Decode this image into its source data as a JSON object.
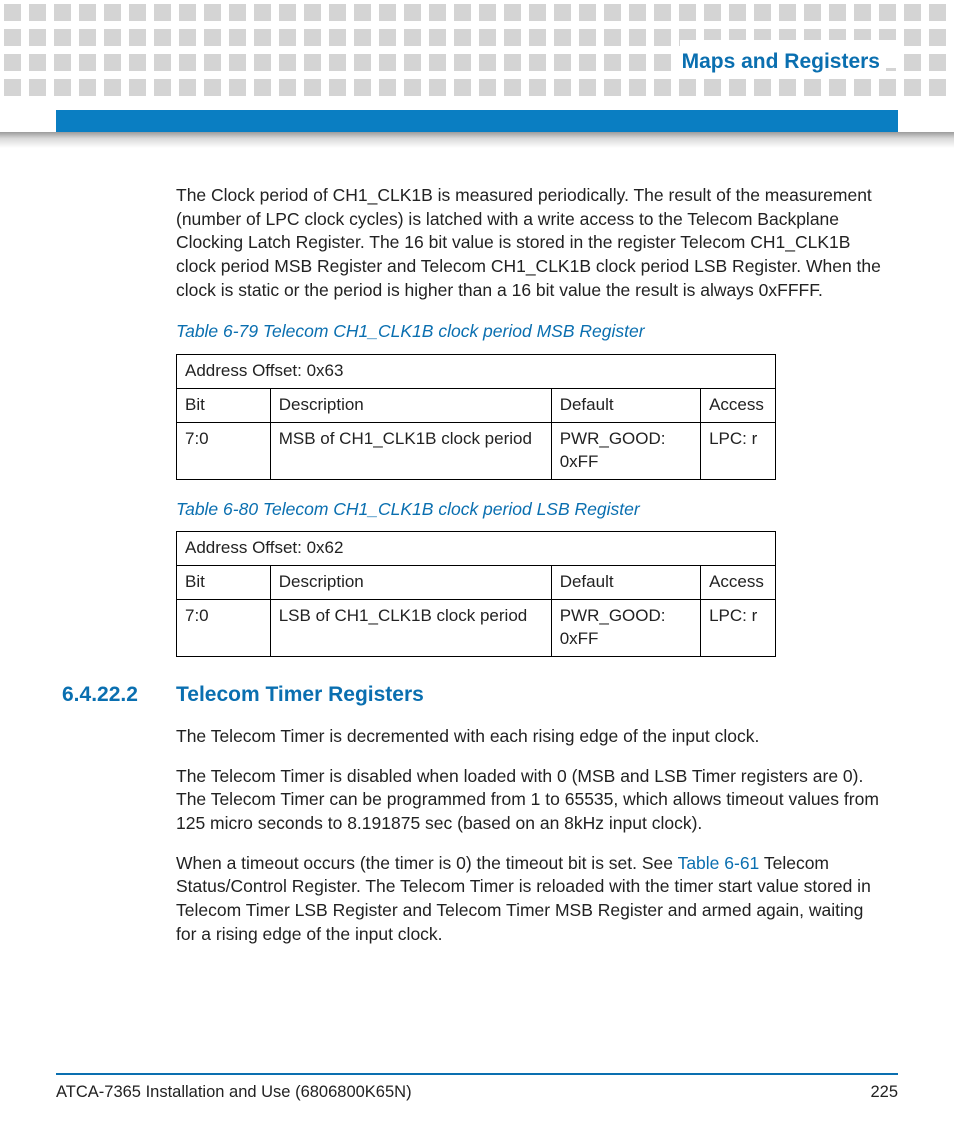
{
  "header": {
    "chapter_title": "Maps and Registers"
  },
  "body": {
    "intro_para": "The Clock period of CH1_CLK1B is measured periodically. The result of the measurement (number of LPC clock cycles) is latched with a write access to the Telecom Backplane Clocking Latch Register. The 16 bit value is stored in the register Telecom CH1_CLK1B clock period MSB Register and Telecom CH1_CLK1B clock period LSB Register. When the clock is static or the period is higher than a 16 bit value the result is always 0xFFFF.",
    "table79": {
      "caption": "Table 6-79 Telecom CH1_CLK1B clock period MSB Register",
      "addr": "Address Offset: 0x63",
      "h_bit": "Bit",
      "h_desc": "Description",
      "h_def": "Default",
      "h_acc": "Access",
      "r_bit": "7:0",
      "r_desc": "MSB of CH1_CLK1B clock period",
      "r_def": "PWR_GOOD: 0xFF",
      "r_acc": "LPC: r"
    },
    "table80": {
      "caption": "Table 6-80 Telecom CH1_CLK1B clock period LSB Register",
      "addr": "Address Offset: 0x62",
      "h_bit": "Bit",
      "h_desc": "Description",
      "h_def": "Default",
      "h_acc": "Access",
      "r_bit": "7:0",
      "r_desc": "LSB of CH1_CLK1B clock period",
      "r_def": "PWR_GOOD: 0xFF",
      "r_acc": "LPC: r"
    },
    "section": {
      "num": "6.4.22.2",
      "title": "Telecom Timer Registers",
      "p1": "The Telecom Timer is decremented with each rising edge of the input clock.",
      "p2": "The Telecom Timer is disabled when loaded with 0 (MSB and LSB Timer registers are 0). The Telecom Timer can be programmed from 1 to 65535, which allows timeout values from 125 micro seconds to 8.191875 sec (based on an 8kHz input clock).",
      "p3_pre": "When a timeout occurs (the timer is 0) the timeout bit is set. See ",
      "p3_link": "Table 6-61",
      "p3_post": " Telecom Status/Control Register. The Telecom Timer is reloaded with the timer start value stored in Telecom Timer LSB Register and Telecom Timer MSB Register and armed again, waiting for a rising edge of the input clock."
    }
  },
  "footer": {
    "doc_title": "ATCA-7365 Installation and Use (6806800K65N)",
    "page_num": "225"
  }
}
